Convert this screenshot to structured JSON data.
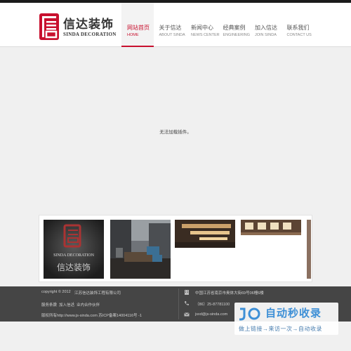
{
  "brand": {
    "name_cn": "信达装饰",
    "name_en": "SINDA DECORATION",
    "color": "#c8102e"
  },
  "nav": [
    {
      "cn": "网站首页",
      "en": "HOME",
      "active": true
    },
    {
      "cn": "关于信达",
      "en": "ABOUT SINDA",
      "active": false
    },
    {
      "cn": "新闻中心",
      "en": "NEWS CENTER",
      "active": false
    },
    {
      "cn": "经典案例",
      "en": "ENGINEERING",
      "active": false
    },
    {
      "cn": "加入信达",
      "en": "JOIN SINDA",
      "active": false
    },
    {
      "cn": "联系我们",
      "en": "CONTACT US",
      "active": false
    }
  ],
  "plugin_notice": "无法加载插件。",
  "gallery": {
    "thumb1_overlay_en": "SINDA DECORATION",
    "thumb1_overlay_cn": "信达装饰"
  },
  "footer": {
    "copyright": "copyright © 2012",
    "company": "江苏信达装饰工程有限公司",
    "links": [
      "服务条款",
      "加入信达",
      "业内合作伙伴"
    ],
    "site_line": "版权所有http://www.js-sinda.com 苏ICP备案14004116号 -1",
    "address": "中国江苏省南京市奥体大街69号06幢6楼",
    "phone": "（86）25-87781100",
    "email": "jsxd@js-sinda.com"
  },
  "watermark": {
    "title": "自动秒收录",
    "subtitle": "做上链接→来访一次→自动收录"
  },
  "icons": [
    "building-icon",
    "phone-icon",
    "mail-icon"
  ]
}
